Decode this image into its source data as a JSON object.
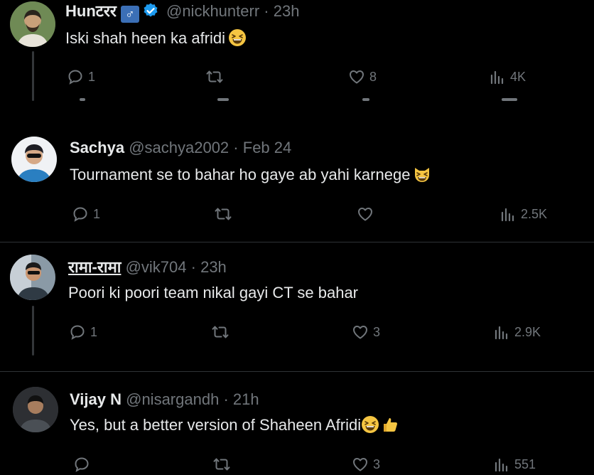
{
  "tweets": [
    {
      "name": "Hunटरर",
      "gender_badge": "♂",
      "verified": true,
      "handle": "@nickhunterr",
      "dot": "·",
      "time": "23h",
      "text": "Iski shah heen ka afridi",
      "emoji": "grinning-squinting-face",
      "replies": "1",
      "retweets": "",
      "likes": "8",
      "views": "4K"
    },
    {
      "name": "Sachya",
      "handle": "@sachya2002",
      "dot": "·",
      "time": "Feb 24",
      "text": "Tournament se to bahar ho gaye ab yahi karnege",
      "emoji": "grinning-cat-squinting",
      "replies": "1",
      "retweets": "",
      "likes": "",
      "views": "2.5K"
    },
    {
      "name": "रामा-रामा",
      "handle": "@vik704",
      "dot": "·",
      "time": "23h",
      "text": "Poori ki poori team nikal gayi CT se bahar",
      "replies": "1",
      "retweets": "",
      "likes": "3",
      "views": "2.9K"
    },
    {
      "name": "Vijay N",
      "handle": "@nisargandh",
      "dot": "·",
      "time": "21h",
      "text": "Yes, but a better version of Shaheen Afridi",
      "emoji": "grinning-face-thumbs-up",
      "replies": "",
      "retweets": "",
      "likes": "3",
      "views": "551"
    }
  ],
  "colors": {
    "background": "#000000",
    "text": "#e7e9ea",
    "muted": "#71767b",
    "divider": "#2f3336",
    "verified": "#1d9bf0",
    "emoji": "#f5c542"
  }
}
